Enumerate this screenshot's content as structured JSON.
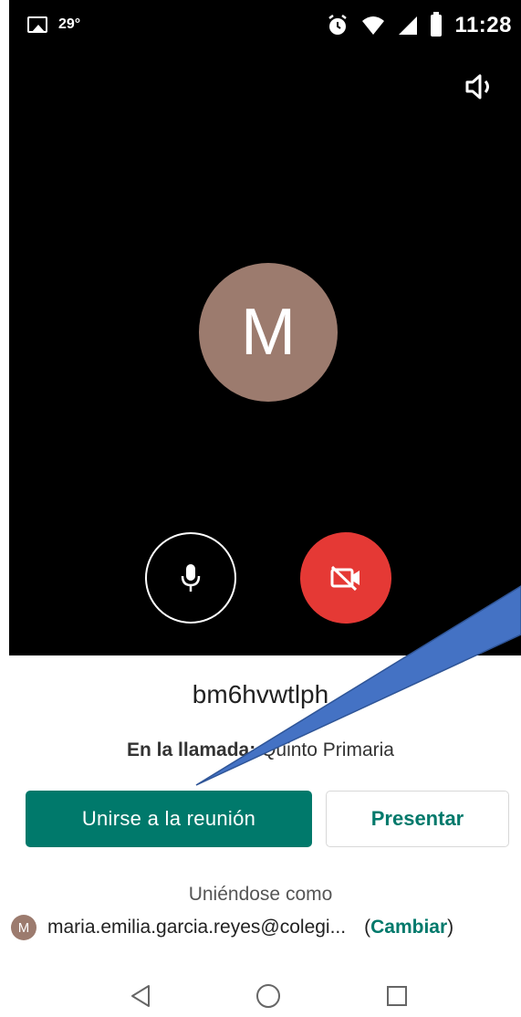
{
  "status_bar": {
    "temperature": "29°",
    "time": "11:28",
    "icons": [
      "image-icon",
      "alarm-icon",
      "wifi-icon",
      "signal-icon",
      "battery-icon"
    ]
  },
  "preview": {
    "avatar_initial": "M",
    "speaker_icon": "speaker-icon",
    "mic_icon": "microphone-icon",
    "camera_icon": "camera-off-icon",
    "camera_button_color": "#e53935"
  },
  "meeting": {
    "code": "bm6hvwtlph",
    "in_call_label": "En la llamada:",
    "in_call_value": "Quinto Primaria"
  },
  "buttons": {
    "join": "Unirse a la reunión",
    "present": "Presentar"
  },
  "account": {
    "joining_as": "Uniéndose como",
    "avatar_initial": "M",
    "email": "maria.emilia.garcia.reyes@colegi...",
    "change_open": "(",
    "change_label": "Cambiar",
    "change_close": ")"
  },
  "colors": {
    "accent": "#00796b",
    "avatar": "#9c7b6e",
    "annotation_arrow": "#4472c4"
  }
}
